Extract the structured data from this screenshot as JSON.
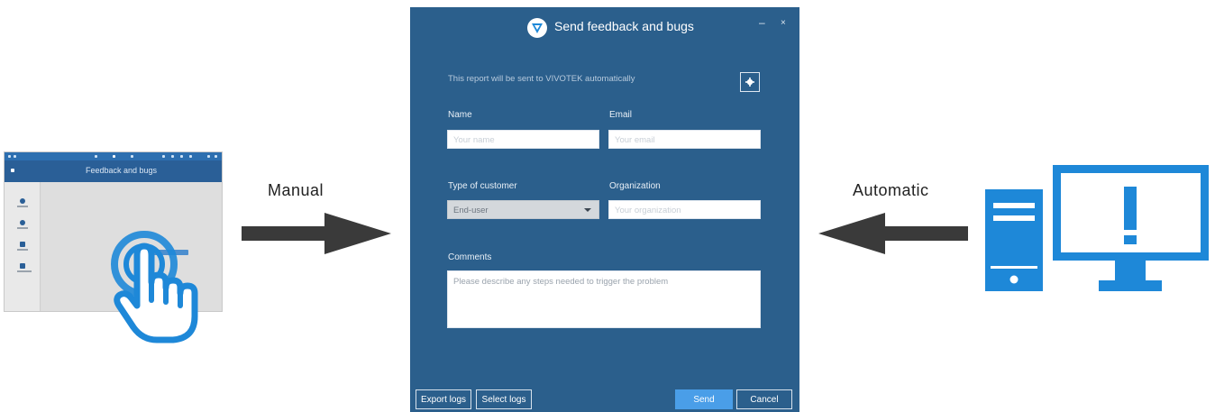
{
  "labels": {
    "manual": "Manual",
    "automatic": "Automatic"
  },
  "thumbnail": {
    "header_title": "Feedback and bugs"
  },
  "dialog": {
    "title": "Send feedback and bugs",
    "minimize_symbol": "–",
    "close_symbol": "×",
    "note": "This report will be sent to VIVOTEK automatically",
    "name_label": "Name",
    "name_placeholder": "Your name",
    "email_label": "Email",
    "email_placeholder": "Your email",
    "customer_type_label": "Type of customer",
    "customer_type_value": "End-user",
    "organization_label": "Organization",
    "organization_placeholder": "Your organization",
    "comments_label": "Comments",
    "comments_placeholder": "Please describe any steps needed to trigger the problem",
    "buttons": {
      "export_logs": "Export logs",
      "select_logs": "Select logs",
      "send": "Send",
      "cancel": "Cancel"
    }
  },
  "colors": {
    "dialog_bg": "#2b5f8c",
    "accent_blue": "#1e88d8",
    "arrow": "#3a3a3a",
    "send_button": "#4a9ee8"
  },
  "icons": {
    "hand": "hand-pointer-icon",
    "computer": "computer-alert-icon",
    "settings": "gear-icon",
    "logo": "vivotek-logo-icon"
  }
}
